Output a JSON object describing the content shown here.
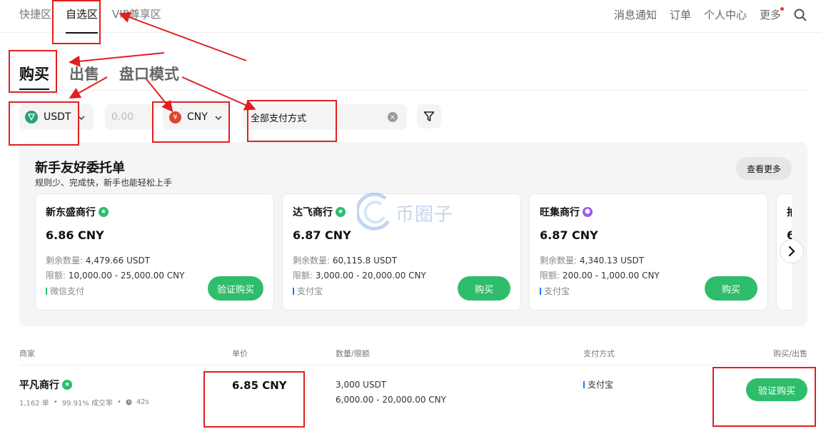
{
  "topnav": {
    "left_items": [
      "快捷区",
      "自选区",
      "VIP尊享区"
    ],
    "active_index": 1,
    "right_items": [
      "消息通知",
      "订单",
      "个人中心",
      "更多"
    ]
  },
  "tabs": {
    "items": [
      "购买",
      "出售",
      "盘口模式"
    ],
    "active_index": 0
  },
  "filters": {
    "coin": "USDT",
    "amount_placeholder": "0.00",
    "fiat_symbol": "¥",
    "fiat": "CNY",
    "payment": "全部支付方式"
  },
  "promo": {
    "title": "新手友好委托单",
    "subtitle": "规则少、完成快，新手也能轻松上手",
    "see_more": "查看更多",
    "remaining_label": "剩余数量:",
    "limit_label": "限额:",
    "cards": [
      {
        "merchant": "新东盛商行",
        "badge_color": "#2ebd6b",
        "price": "6.86 CNY",
        "remaining": "4,479.66 USDT",
        "limit": "10,000.00 - 25,000.00 CNY",
        "payment": "微信支付",
        "payment_color": "#2ebd6b",
        "action": "验证购买"
      },
      {
        "merchant": "达飞商行",
        "badge_color": "#2ebd6b",
        "price": "6.87 CNY",
        "remaining": "60,115.8 USDT",
        "limit": "3,000.00 - 20,000.00 CNY",
        "payment": "支付宝",
        "payment_color": "#1677ff",
        "action": "购买"
      },
      {
        "merchant": "旺集商行",
        "badge_color": "#9b59f6",
        "price": "6.87 CNY",
        "remaining": "4,340.13 USDT",
        "limit": "200.00 - 1,000.00 CNY",
        "payment": "支付宝",
        "payment_color": "#1677ff",
        "action": "购买"
      },
      {
        "merchant": "拍",
        "badge_color": "#2ebd6b",
        "price": "6",
        "remaining": "",
        "limit": "",
        "payment": "",
        "payment_color": "#1677ff",
        "action": ""
      }
    ]
  },
  "table": {
    "headers": [
      "商家",
      "单价",
      "数量/限额",
      "支付方式",
      "购买/出售"
    ],
    "rows": [
      {
        "merchant": "平凡商行",
        "orders": "1,162 单",
        "completion": "99.91% 成交率",
        "time": "42s",
        "price": "6.85 CNY",
        "quantity": "3,000 USDT",
        "limit": "6,000.00 - 20,000.00 CNY",
        "payment": "支付宝",
        "action": "验证购买"
      }
    ]
  },
  "watermark": "币圈子",
  "colors": {
    "accent_green": "#2ebd6b",
    "annotation_red": "#e02020",
    "tether": "#26a17b",
    "alipay": "#1677ff"
  }
}
